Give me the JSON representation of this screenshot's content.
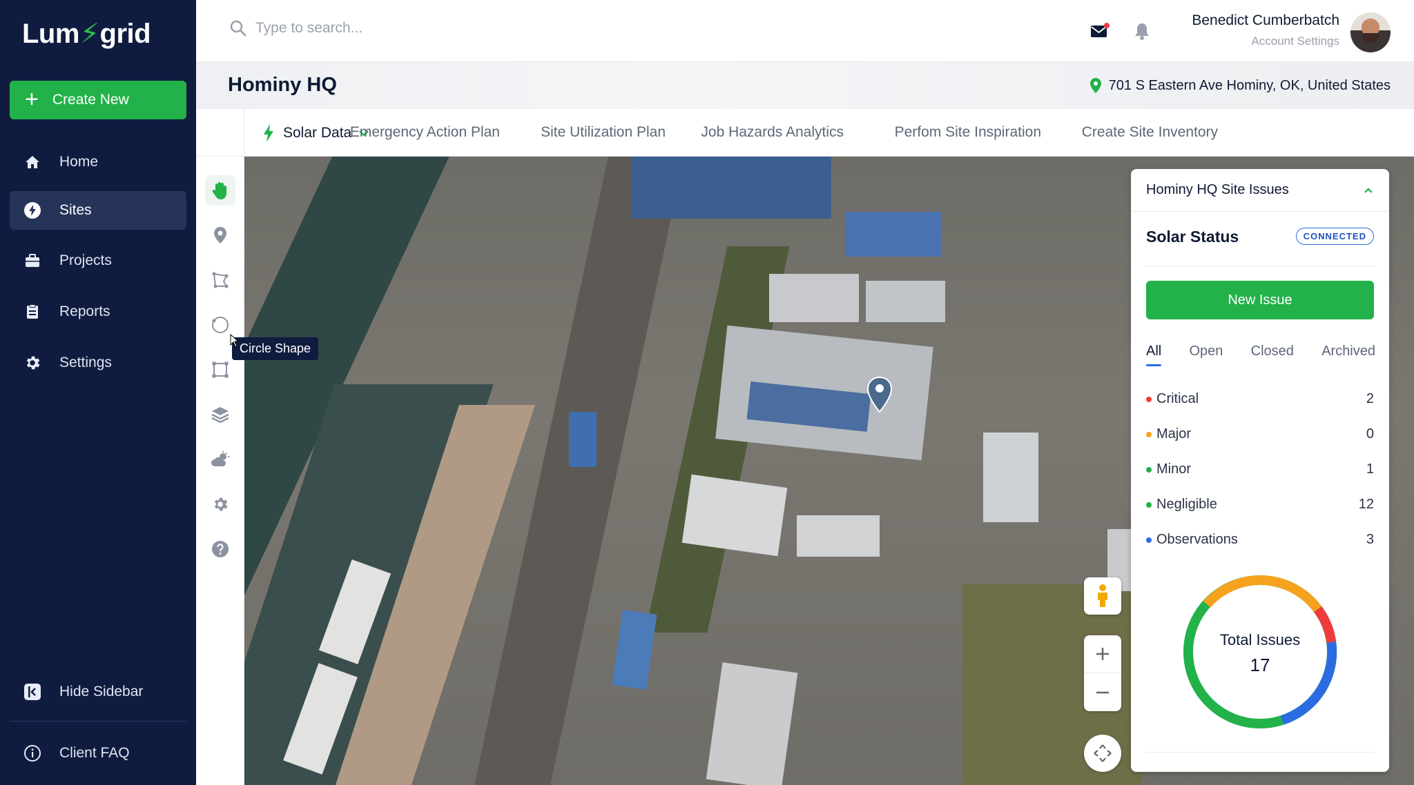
{
  "app": {
    "logo_left": "Lum",
    "logo_bolt": "⚡",
    "logo_right": "grid"
  },
  "sidebar": {
    "create_label": "Create New",
    "items": [
      {
        "label": "Home",
        "icon": "home-icon"
      },
      {
        "label": "Sites",
        "icon": "bolt-icon",
        "active": true
      },
      {
        "label": "Projects",
        "icon": "briefcase-icon"
      },
      {
        "label": "Reports",
        "icon": "clipboard-icon"
      },
      {
        "label": "Settings",
        "icon": "gear-icon"
      }
    ],
    "hide_label": "Hide Sidebar",
    "faq_label": "Client FAQ"
  },
  "header": {
    "search_placeholder": "Type to search...",
    "user_name": "Benedict Cumberbatch",
    "user_sub": "Account Settings"
  },
  "site": {
    "title": "Hominy HQ",
    "address": "701 S Eastern Ave Hominy, OK, United States"
  },
  "tabs": {
    "dropdown_label": "Solar Data",
    "items": [
      "Emergency Action Plan",
      "Site Utilization Plan",
      "Job Hazards Analytics",
      "Perfom Site Inspiration",
      "Create Site Inventory"
    ]
  },
  "tools": {
    "tooltip": "Circle Shape"
  },
  "panel": {
    "title": "Hominy HQ Site Issues",
    "status_label": "Solar Status",
    "status_badge": "CONNECTED",
    "new_issue": "New Issue",
    "filters": [
      "All",
      "Open",
      "Closed",
      "Archived"
    ],
    "severities": [
      {
        "label": "Critical",
        "count": "2",
        "color": "#ef3b3b"
      },
      {
        "label": "Major",
        "count": "0",
        "color": "#f6a21e"
      },
      {
        "label": "Minor",
        "count": "1",
        "color": "#23b14a"
      },
      {
        "label": "Negligible",
        "count": "12",
        "color": "#23b14a"
      },
      {
        "label": "Observations",
        "count": "3",
        "color": "#2b6de0"
      }
    ],
    "total_label": "Total Issues",
    "total_value": "17"
  },
  "colors": {
    "sidebar_bg": "#0f1c3f",
    "accent_green": "#23b14a",
    "accent_blue": "#2b6de0"
  }
}
